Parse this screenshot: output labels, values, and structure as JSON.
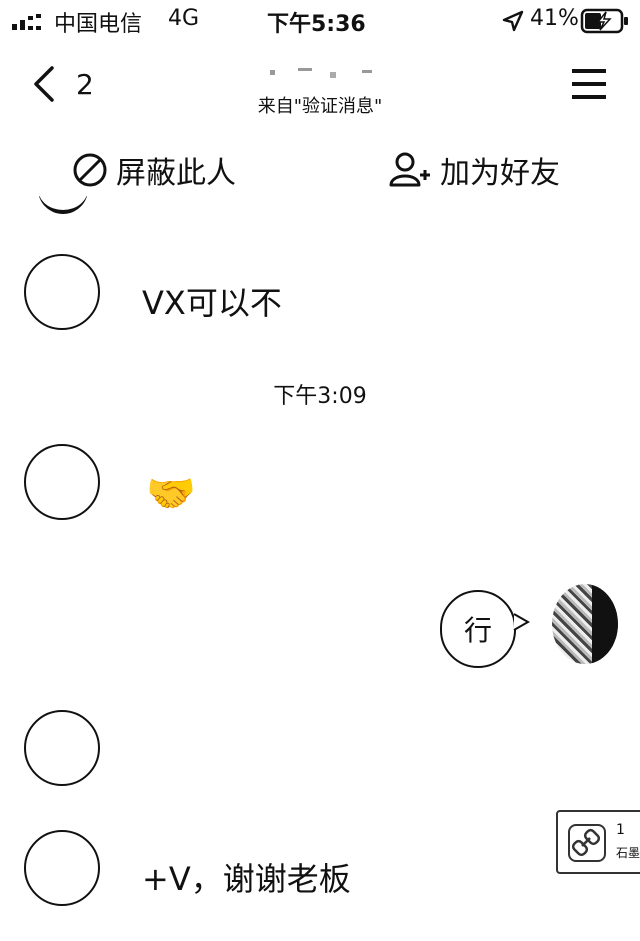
{
  "status_bar": {
    "carrier": "中国电信",
    "network": "4G",
    "time": "下午5:36",
    "battery": "41%"
  },
  "nav": {
    "back_count": "2",
    "subtitle": "来自\"验证消息\""
  },
  "actions": {
    "block_label": "屏蔽此人",
    "add_friend_label": "加为好友"
  },
  "messages": [
    {
      "text": "VX可以不"
    },
    {
      "time": "下午3:09"
    },
    {
      "emoji": "🤝"
    },
    {
      "text": "行"
    },
    {
      "text": "+V，谢谢老板"
    }
  ],
  "link_card": {
    "count": "1",
    "source": "石墨"
  }
}
